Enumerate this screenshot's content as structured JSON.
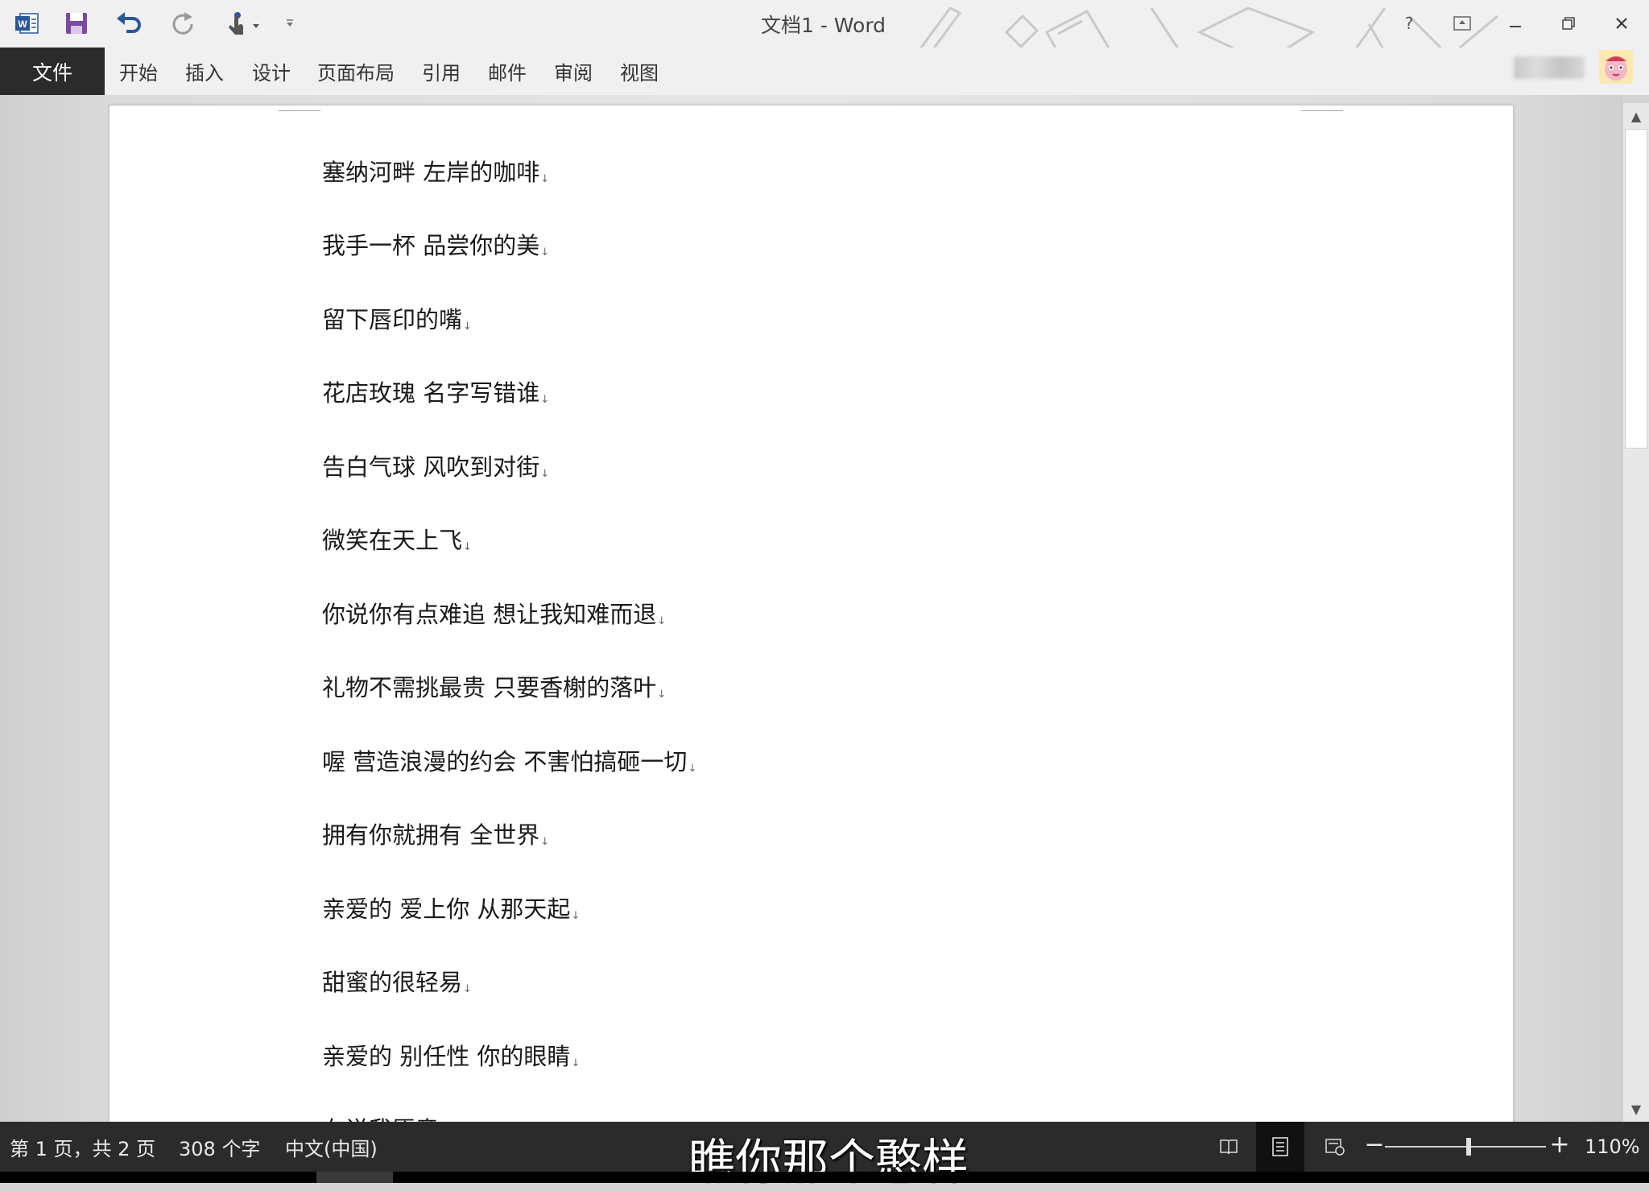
{
  "window": {
    "title": "文档1 - Word",
    "help": "?"
  },
  "ribbon": {
    "file_tab": "文件",
    "tabs": [
      "开始",
      "插入",
      "设计",
      "页面布局",
      "引用",
      "邮件",
      "审阅",
      "视图"
    ]
  },
  "document": {
    "lines": [
      "塞纳河畔  左岸的咖啡",
      "我手一杯  品尝你的美",
      "留下唇印的嘴",
      "花店玫瑰  名字写错谁",
      "告白气球  风吹到对街",
      "微笑在天上飞",
      "你说你有点难追  想让我知难而退",
      "礼物不需挑最贵  只要香榭的落叶",
      "喔  营造浪漫的约会  不害怕搞砸一切",
      "拥有你就拥有  全世界",
      "亲爱的  爱上你  从那天起",
      "甜蜜的很轻易",
      "亲爱的  别任性  你的眼睛",
      "在说我愿意"
    ],
    "paragraph_mark": "↓"
  },
  "statusbar": {
    "page_info": "第 1 页，共 2 页",
    "word_count": "308 个字",
    "language": "中文(中国)",
    "zoom": "110%",
    "zoom_minus": "−",
    "zoom_plus": "+",
    "zoom_fraction": 0.52
  },
  "overlay": {
    "caption": "瞧你那个憨样"
  },
  "colors": {
    "word_blue": "#2b579a",
    "save_purple": "#7b4a9e",
    "file_tab_bg": "#2b2b2b",
    "status_bg": "#2b2b2b"
  }
}
